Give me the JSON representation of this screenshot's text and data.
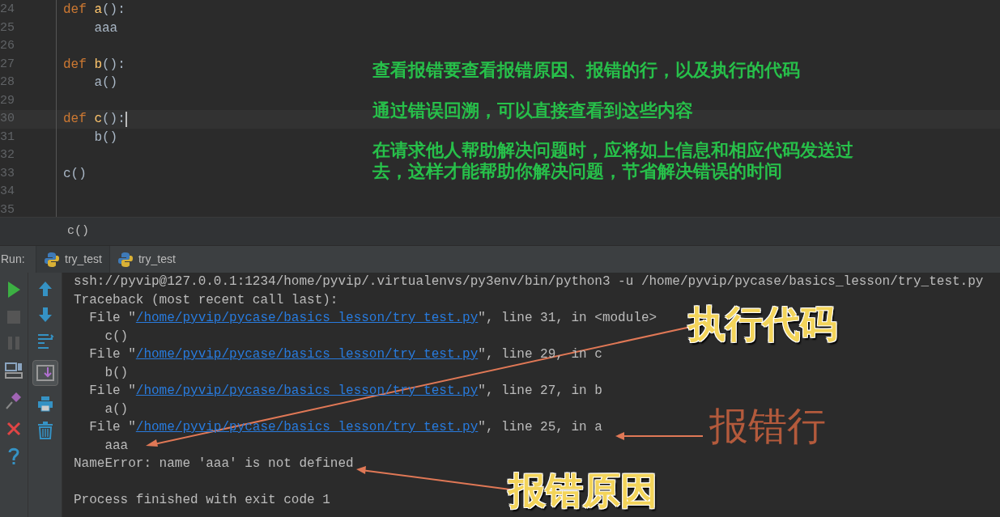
{
  "editor": {
    "lines": [
      {
        "number": "24",
        "current": false,
        "segments": [
          {
            "text": "def ",
            "kind": "keyword"
          },
          {
            "text": "a",
            "kind": "function"
          },
          {
            "text": "():",
            "kind": "plain"
          }
        ]
      },
      {
        "number": "25",
        "current": false,
        "segments": [
          {
            "text": "    aaa",
            "kind": "plain"
          }
        ]
      },
      {
        "number": "26",
        "current": false
      },
      {
        "number": "27",
        "current": false,
        "segments": [
          {
            "text": "def ",
            "kind": "keyword"
          },
          {
            "text": "b",
            "kind": "function"
          },
          {
            "text": "():",
            "kind": "plain"
          }
        ]
      },
      {
        "number": "28",
        "current": false,
        "segments": [
          {
            "text": "    a()",
            "kind": "plain"
          }
        ]
      },
      {
        "number": "29",
        "current": false
      },
      {
        "number": "30",
        "current": true,
        "segments": [
          {
            "text": "def ",
            "kind": "keyword"
          },
          {
            "text": "c",
            "kind": "function"
          },
          {
            "text": "():",
            "kind": "plain"
          }
        ]
      },
      {
        "number": "31",
        "current": false,
        "segments": [
          {
            "text": "    b()",
            "kind": "plain"
          }
        ]
      },
      {
        "number": "32",
        "current": false
      },
      {
        "number": "33",
        "current": false,
        "segments": [
          {
            "text": "c()",
            "kind": "plain"
          }
        ]
      },
      {
        "number": "34",
        "current": false
      },
      {
        "number": "35",
        "current": false
      }
    ],
    "notes": [
      "查看报错要查看报错原因、报错的行，以及执行的代码",
      "通过错误回溯，可以直接查看到这些内容",
      "在请求他人帮助解决问题时，应将如上信息和相应代码发送过去，这样才能帮助你解决问题，节省解决错误的时间"
    ]
  },
  "breadcrumb": "c()",
  "run_panel": {
    "label": "Run:",
    "tabs": [
      {
        "label": "try_test",
        "selected": true
      },
      {
        "label": "try_test",
        "selected": false
      }
    ],
    "console": [
      {
        "segments": [
          {
            "text": "ssh://pyvip@127.0.0.1:1234/home/pyvip/.virtualenvs/py3env/bin/python3 -u /home/pyvip/pycase/basics_lesson/try_test.py",
            "kind": "text"
          }
        ]
      },
      {
        "segments": [
          {
            "text": "Traceback (most recent call last):",
            "kind": "text"
          }
        ]
      },
      {
        "segments": [
          {
            "text": "  File \"",
            "kind": "text"
          },
          {
            "text": "/home/pyvip/pycase/basics_lesson/try_test.py",
            "kind": "link"
          },
          {
            "text": "\", line 31, in <module>",
            "kind": "text"
          }
        ]
      },
      {
        "segments": [
          {
            "text": "    c()",
            "kind": "text"
          }
        ]
      },
      {
        "segments": [
          {
            "text": "  File \"",
            "kind": "text"
          },
          {
            "text": "/home/pyvip/pycase/basics_lesson/try_test.py",
            "kind": "link"
          },
          {
            "text": "\", line 29, in c",
            "kind": "text"
          }
        ]
      },
      {
        "segments": [
          {
            "text": "    b()",
            "kind": "text"
          }
        ]
      },
      {
        "segments": [
          {
            "text": "  File \"",
            "kind": "text"
          },
          {
            "text": "/home/pyvip/pycase/basics_lesson/try_test.py",
            "kind": "link"
          },
          {
            "text": "\", line 27, in b",
            "kind": "text"
          }
        ]
      },
      {
        "segments": [
          {
            "text": "    a()",
            "kind": "text"
          }
        ]
      },
      {
        "segments": [
          {
            "text": "  File \"",
            "kind": "text"
          },
          {
            "text": "/home/pyvip/pycase/basics_lesson/try_test.py",
            "kind": "link"
          },
          {
            "text": "\", line 25, in a",
            "kind": "text"
          }
        ]
      },
      {
        "segments": [
          {
            "text": "    aaa",
            "kind": "text"
          }
        ]
      },
      {
        "segments": [
          {
            "text": "NameError: name 'aaa' is not defined",
            "kind": "text"
          }
        ]
      },
      {
        "spaced": true,
        "segments": [
          {
            "text": "Process finished with exit code 1",
            "kind": "text"
          }
        ]
      }
    ]
  },
  "callouts": [
    {
      "text": "执行代码",
      "kind": "gold"
    },
    {
      "text": "报错行",
      "kind": "brown"
    },
    {
      "text": "报错原因",
      "kind": "gold"
    }
  ]
}
